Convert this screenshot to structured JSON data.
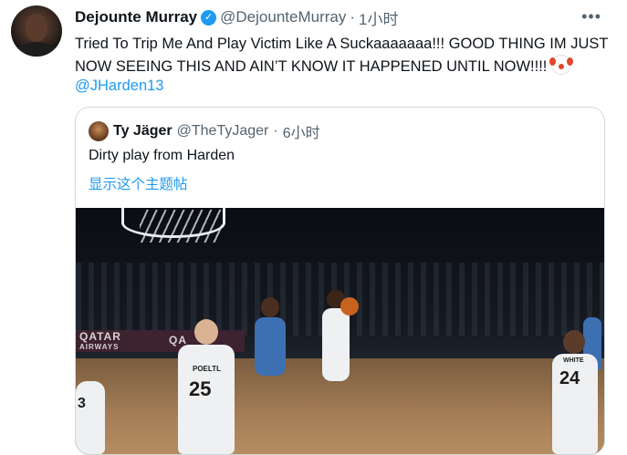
{
  "author": {
    "display_name": "Dejounte Murray",
    "handle": "@DejounteMurray",
    "separator": "·",
    "time": "1小时"
  },
  "icons": {
    "avatar": "profile-photo",
    "verified": "verified-badge-icon",
    "more": "more-options-icon",
    "emoji": "clown-face-emoji"
  },
  "tweet": {
    "text": "Tried To Trip Me And Play Victim Like A Suckaaaaaaa!!! GOOD THING IM JUST NOW SEEING THIS AND AIN’T KNOW IT HAPPENED UNTIL NOW!!!! ",
    "mention": "@JHarden13"
  },
  "quoted": {
    "display_name": "Ty Jäger",
    "handle": "@TheTyJager",
    "separator": "·",
    "time": "6小时",
    "text": "Dirty play from Harden",
    "translate_link": "显示这个主题帖",
    "video": {
      "ad_left": "QATAR",
      "ad_left_sub": "AIRWAYS",
      "ad_right": "QA",
      "jersey_left_number": "25",
      "jersey_left_name": "POELTL",
      "jersey_right_number": "24",
      "jersey_right_name": "WHITE",
      "jersey_edge_number": "3"
    }
  },
  "colors": {
    "link": "#1d9bf0",
    "secondary_text": "#536471",
    "border": "#cfd9de"
  }
}
